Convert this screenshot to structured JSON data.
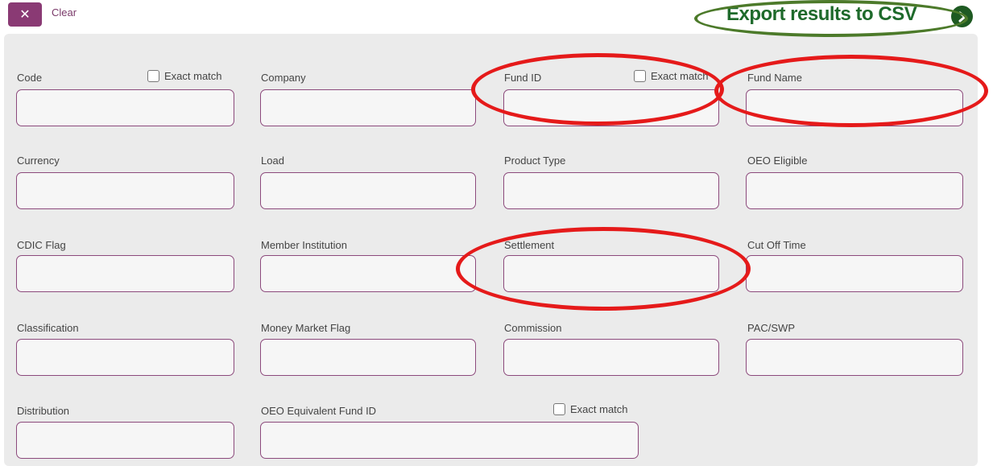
{
  "toolbar": {
    "clear_label": "Clear",
    "export_label": "Export results to CSV",
    "export_icon": "arrow-right-circle-icon",
    "clear_icon": "close-icon"
  },
  "filters": {
    "code_label": "Code",
    "code_exact": "Exact match",
    "company_label": "Company",
    "fund_id_label": "Fund ID",
    "fund_id_exact": "Exact match",
    "fund_name_label": "Fund Name",
    "currency_label": "Currency",
    "load_label": "Load",
    "product_type_label": "Product Type",
    "oeo_eligible_label": "OEO Eligible",
    "cdic_flag_label": "CDIC Flag",
    "member_institution_label": "Member Institution",
    "settlement_label": "Settlement",
    "cut_off_time_label": "Cut Off Time",
    "classification_label": "Classification",
    "money_market_flag_label": "Money Market Flag",
    "commission_label": "Commission",
    "pac_swp_label": "PAC/SWP",
    "distribution_label": "Distribution",
    "oeo_equiv_label": "OEO Equivalent Fund ID",
    "oeo_equiv_exact": "Exact match"
  },
  "colors": {
    "accent": "#8a3a74",
    "export_green": "#1e6a2b",
    "annotation_red": "#e51a1a",
    "annotation_green": "#4c7a2a"
  }
}
